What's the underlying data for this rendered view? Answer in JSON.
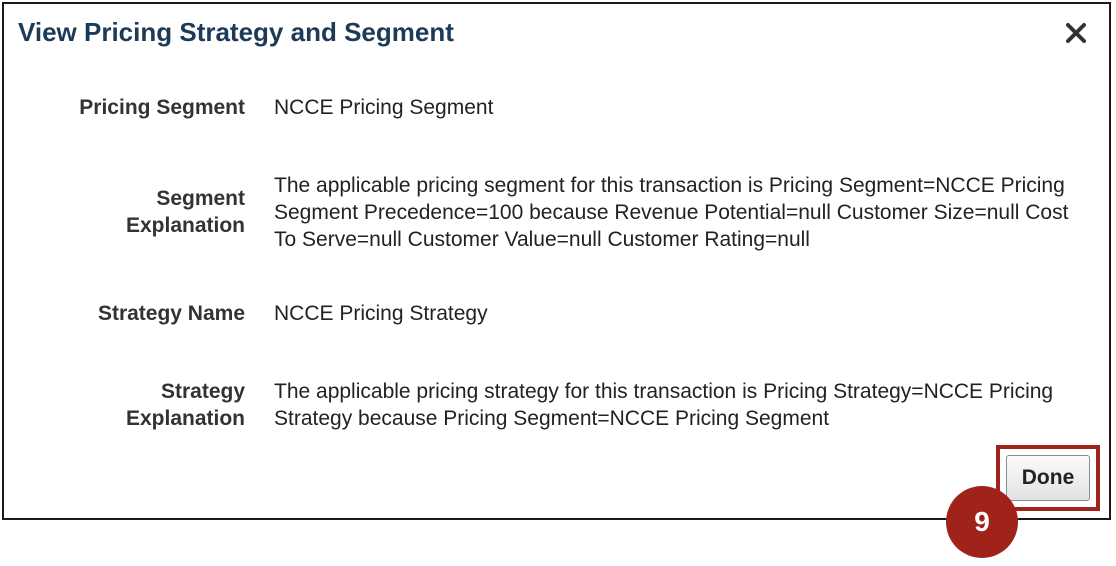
{
  "dialog": {
    "title": "View Pricing Strategy and Segment",
    "close_icon": "close-icon"
  },
  "fields": {
    "pricing_segment": {
      "label": "Pricing Segment",
      "value": "NCCE Pricing Segment"
    },
    "segment_explanation": {
      "label": "Segment Explanation",
      "value": "The applicable pricing segment for this transaction is Pricing Segment=NCCE Pricing Segment Precedence=100 because Revenue Potential=null Customer Size=null Cost To Serve=null Customer Value=null Customer Rating=null"
    },
    "strategy_name": {
      "label": "Strategy Name",
      "value": "NCCE Pricing Strategy"
    },
    "strategy_explanation": {
      "label": "Strategy Explanation",
      "value": "The applicable pricing strategy for this transaction is Pricing Strategy=NCCE Pricing Strategy because Pricing Segment=NCCE Pricing Segment"
    }
  },
  "actions": {
    "done_label": "Done"
  },
  "annotation": {
    "step_number": "9",
    "highlight_color": "#a0231a"
  }
}
